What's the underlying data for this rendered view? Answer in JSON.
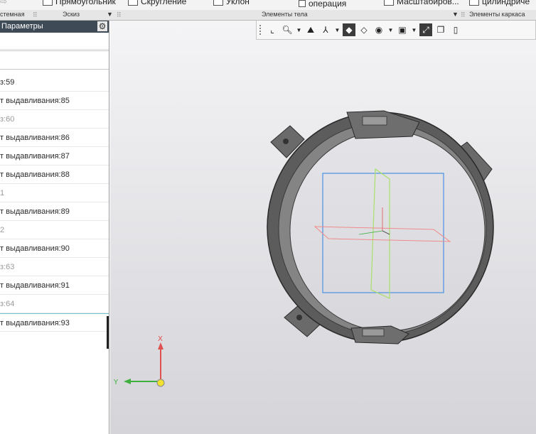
{
  "ribbon": {
    "commands": [
      {
        "label": "Прямоугольник",
        "icon": "rectangle-icon"
      },
      {
        "label": "Скругление",
        "icon": "fillet-icon"
      },
      {
        "label": "Уклон",
        "icon": "draft-icon"
      },
      {
        "label": "операция",
        "icon": "operation-icon"
      },
      {
        "label": "Масштабиров...",
        "icon": "scale-icon"
      },
      {
        "label": "цилиндриче",
        "icon": "cylinder-icon"
      }
    ],
    "groups": {
      "system": "стемная",
      "sketch": "Эскиз",
      "body_elements": "Элементы тела",
      "frame_elements": "Элементы каркаса"
    }
  },
  "panel": {
    "title": "Параметры",
    "search_value": "",
    "tree": [
      {
        "label": "з:59",
        "dim": false
      },
      {
        "label": "т выдавливания:85",
        "dim": false
      },
      {
        "label": "з:60",
        "dim": true
      },
      {
        "label": "т выдавливания:86",
        "dim": false
      },
      {
        "label": "т выдавливания:87",
        "dim": false
      },
      {
        "label": "т выдавливания:88",
        "dim": false
      },
      {
        "label": "1",
        "dim": true
      },
      {
        "label": "т выдавливания:89",
        "dim": false
      },
      {
        "label": "2",
        "dim": true
      },
      {
        "label": "т выдавливания:90",
        "dim": false
      },
      {
        "label": "з:63",
        "dim": true
      },
      {
        "label": "т выдавливания:91",
        "dim": false
      },
      {
        "label": "з:64",
        "dim": true
      },
      {
        "label": "т выдавливания:93",
        "dim": false,
        "selected": true
      }
    ]
  },
  "viewport_toolbar": {
    "tools": [
      "grid-icon",
      "frame-icon",
      "zoom-icon",
      "orient-icon",
      "axes-icon",
      "shaded-icon",
      "wireframe-icon",
      "visibility-icon",
      "camera-icon",
      "connect-icon",
      "window-icon"
    ]
  },
  "triad": {
    "x_label": "X",
    "y_label": "Y"
  },
  "colors": {
    "accent_panel_header": "#3f4a57",
    "plane_front": "#4a90e2",
    "plane_side": "#a8e06a",
    "plane_top": "#f08a8a",
    "axis_x": "#e05050",
    "axis_y": "#40b040",
    "axis_z": "#f0e030"
  }
}
